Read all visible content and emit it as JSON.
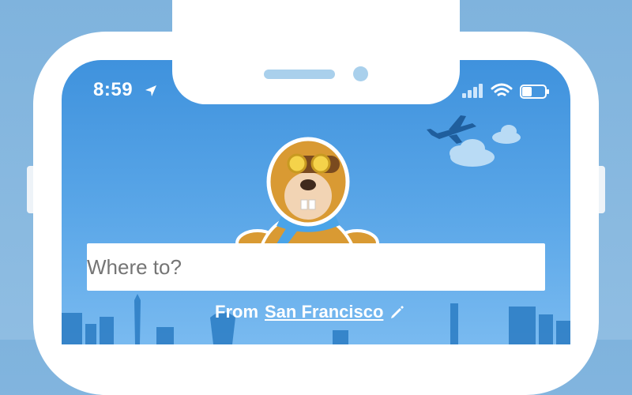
{
  "status_bar": {
    "time": "8:59",
    "icons": [
      "location-arrow-icon",
      "cellular-signal-icon",
      "wifi-icon",
      "battery-icon"
    ]
  },
  "search": {
    "placeholder": "Where to?"
  },
  "origin": {
    "prefix": "From",
    "city": "San Francisco",
    "edit_icon": "pencil-icon"
  },
  "colors": {
    "sky_top": "#3f92dd",
    "sky_bottom": "#79baf0",
    "phone_frame": "#ffffff",
    "mascot_orange": "#d99a33",
    "scarf_blue": "#4aa4e8"
  }
}
